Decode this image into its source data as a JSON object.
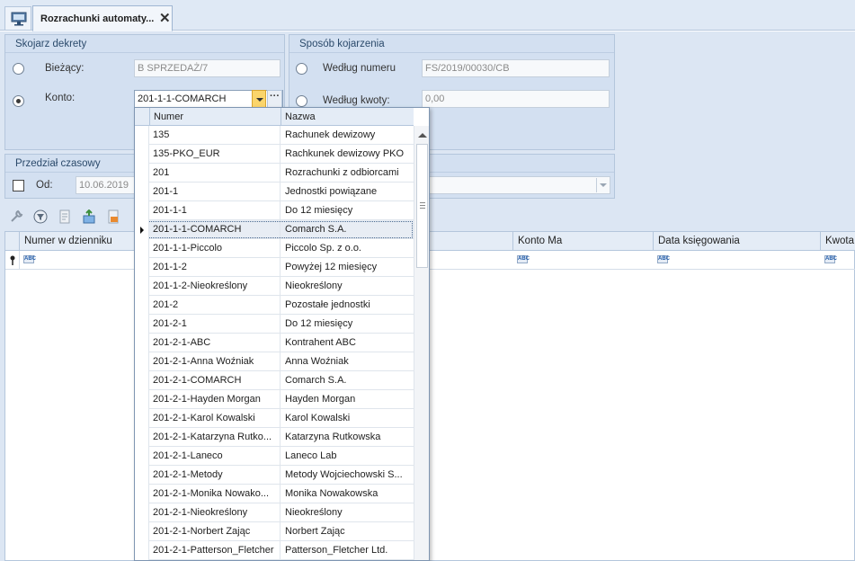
{
  "tabs": {
    "home_icon": "monitor-icon",
    "active_title": "Rozrachunki automaty...",
    "close_glyph": "✕"
  },
  "skojarz": {
    "title": "Skojarz dekrety",
    "biezacy_label": "Bieżący:",
    "biezacy_value": "B SPRZEDAŻ/7",
    "konto_label": "Konto:",
    "konto_value": "201-1-1-COMARCH",
    "dots": "···",
    "selected": "konto"
  },
  "sposob": {
    "title": "Sposób kojarzenia",
    "wg_numeru_label": "Według numeru",
    "wg_numeru_value": "FS/2019/00030/CB",
    "wg_kwoty_label": "Według kwoty:",
    "wg_kwoty_value": "0,00"
  },
  "przedzial": {
    "title": "Przedział czasowy",
    "od_label": "Od:",
    "od_value": "10.06.2019"
  },
  "toolbar": {
    "icons": [
      "wrench-icon",
      "filter-icon",
      "document-icon",
      "import-icon",
      "export-icon"
    ]
  },
  "grid": {
    "columns": [
      "Numer w dzienniku",
      "Konto Ma",
      "Data księgowania",
      "Kwota"
    ],
    "filter_glyph": "ABC"
  },
  "dropdown": {
    "headers": [
      "Numer",
      "Nazwa"
    ],
    "current_index": 5,
    "rows": [
      {
        "numer": "135",
        "nazwa": "Rachunek dewizowy"
      },
      {
        "numer": "135-PKO_EUR",
        "nazwa": "Rachkunek dewizowy PKO"
      },
      {
        "numer": "201",
        "nazwa": "Rozrachunki z odbiorcami"
      },
      {
        "numer": "201-1",
        "nazwa": "Jednostki powiązane"
      },
      {
        "numer": "201-1-1",
        "nazwa": "Do 12 miesięcy"
      },
      {
        "numer": "201-1-1-COMARCH",
        "nazwa": "Comarch S.A."
      },
      {
        "numer": "201-1-1-Piccolo",
        "nazwa": "Piccolo Sp. z o.o."
      },
      {
        "numer": "201-1-2",
        "nazwa": "Powyżej 12 miesięcy"
      },
      {
        "numer": "201-1-2-Nieokreślony",
        "nazwa": "Nieokreślony"
      },
      {
        "numer": "201-2",
        "nazwa": "Pozostałe jednostki"
      },
      {
        "numer": "201-2-1",
        "nazwa": "Do 12 miesięcy"
      },
      {
        "numer": "201-2-1-ABC",
        "nazwa": "Kontrahent ABC"
      },
      {
        "numer": "201-2-1-Anna Woźniak",
        "nazwa": "Anna Woźniak"
      },
      {
        "numer": "201-2-1-COMARCH",
        "nazwa": "Comarch S.A."
      },
      {
        "numer": "201-2-1-Hayden Morgan",
        "nazwa": "Hayden Morgan"
      },
      {
        "numer": "201-2-1-Karol Kowalski",
        "nazwa": "Karol Kowalski"
      },
      {
        "numer": "201-2-1-Katarzyna Rutko...",
        "nazwa": "Katarzyna Rutkowska"
      },
      {
        "numer": "201-2-1-Laneco",
        "nazwa": "Laneco Lab"
      },
      {
        "numer": "201-2-1-Metody",
        "nazwa": "Metody Wojciechowski S..."
      },
      {
        "numer": "201-2-1-Monika Nowako...",
        "nazwa": "Monika Nowakowska"
      },
      {
        "numer": "201-2-1-Nieokreślony",
        "nazwa": "Nieokreślony"
      },
      {
        "numer": "201-2-1-Norbert Zając",
        "nazwa": "Norbert Zając"
      },
      {
        "numer": "201-2-1-Patterson_Fletcher",
        "nazwa": "Patterson_Fletcher Ltd."
      }
    ]
  }
}
